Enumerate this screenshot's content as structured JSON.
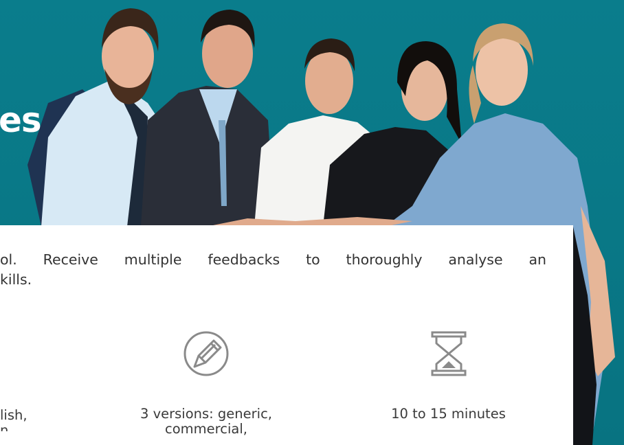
{
  "hero": {
    "title_fragment": "es"
  },
  "card": {
    "description_line1": "ol. Receive multiple feedbacks to thoroughly analyse an",
    "description_line2": "kills."
  },
  "features": {
    "languages": {
      "line1": "lish,",
      "line2": "n"
    },
    "versions": {
      "icon": "pencil-icon",
      "line1": "3 versions: generic,",
      "line2": "commercial,"
    },
    "duration": {
      "icon": "hourglass-icon",
      "line1": "10 to 15 minutes"
    }
  },
  "colors": {
    "hero_bg": "#0b7c8a",
    "card_bg": "#ffffff",
    "icon_gray": "#8a8a8a"
  }
}
